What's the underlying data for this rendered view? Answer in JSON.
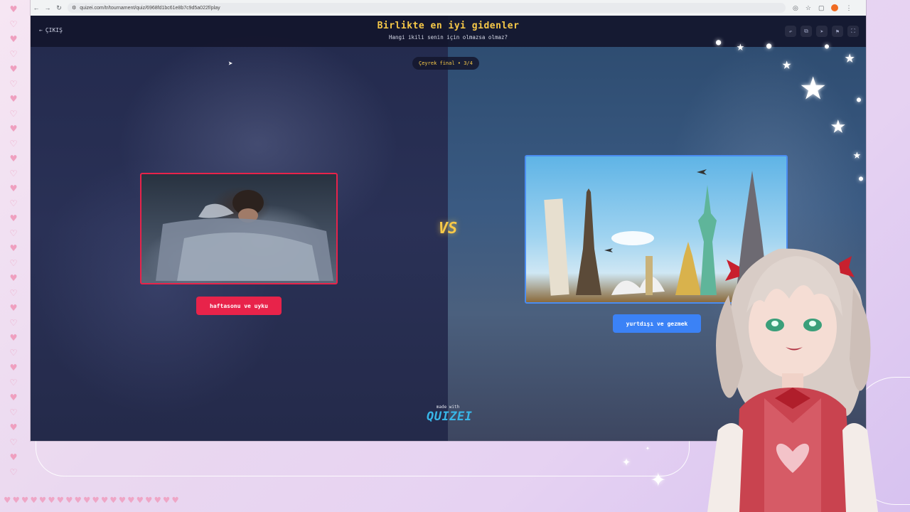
{
  "browser": {
    "url": "quizei.com/tr/tournament/quiz/6968fd1bc61e8b7c9d5a022f/play"
  },
  "header": {
    "exit_label": "ÇIKIŞ",
    "title": "Birlikte en iyi gidenler",
    "subtitle": "Hangi ikili senin için olmazsa olmaz?"
  },
  "round": {
    "label": "Çeyrek final • 3/4"
  },
  "choices": {
    "left": {
      "label": "haftasonu ve uyku",
      "accent": "#e8234a"
    },
    "right": {
      "label": "yurtdışı ve gezmek",
      "accent": "#3b82f6"
    }
  },
  "vs": {
    "label": "VS"
  },
  "footer": {
    "made_with": "made with",
    "brand": "QUIZEI"
  },
  "colors": {
    "title": "#f7c948",
    "left_accent": "#e8234a",
    "right_accent": "#3b82f6",
    "brand": "#38b6e8"
  }
}
